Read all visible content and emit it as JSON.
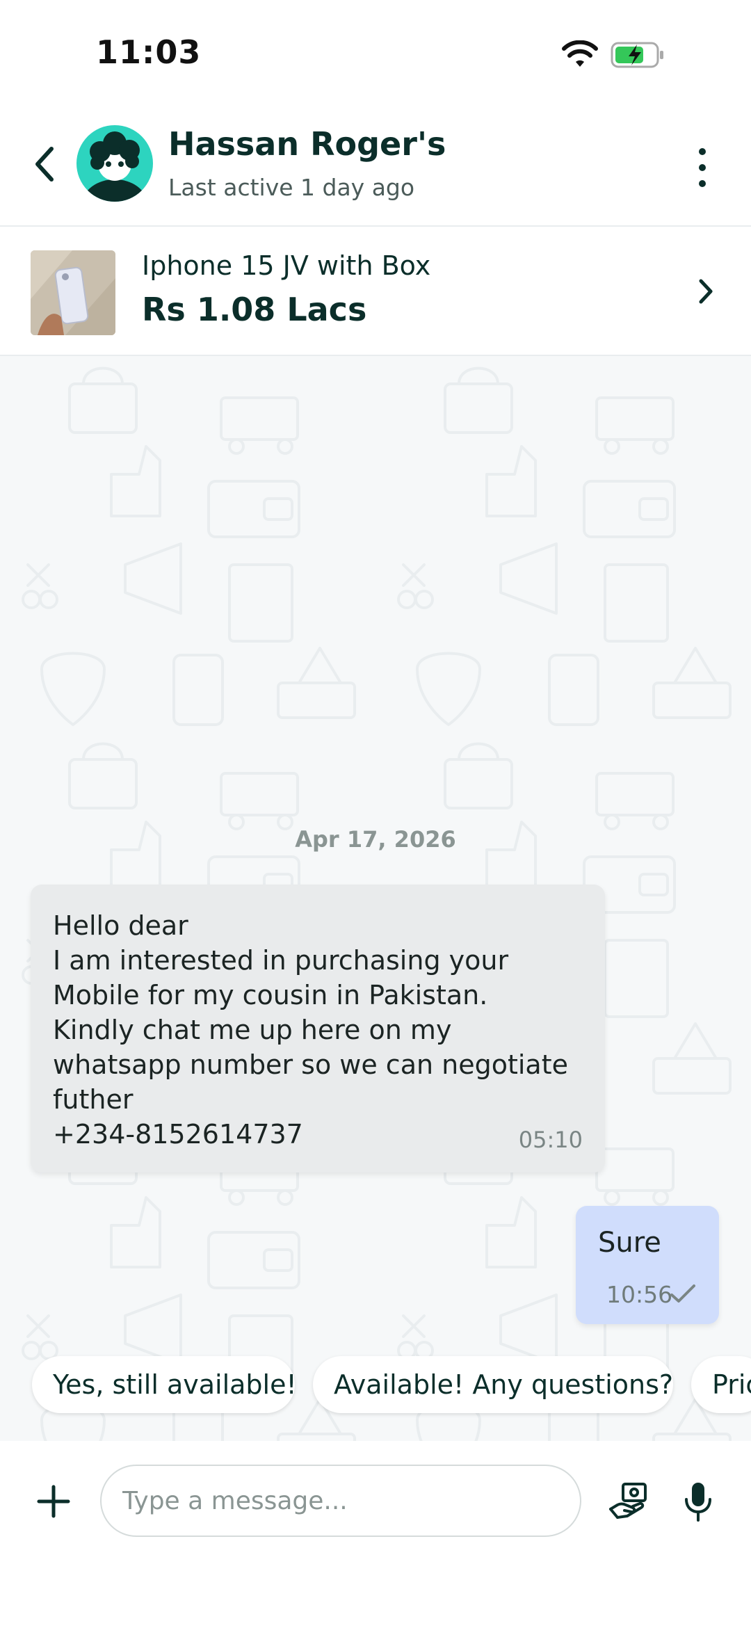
{
  "status_bar": {
    "time": "11:03"
  },
  "header": {
    "name": "Hassan Roger's",
    "last_active": "Last active 1 day ago"
  },
  "listing": {
    "title": "Iphone 15 JV with Box",
    "price": "Rs 1.08 Lacs"
  },
  "chat": {
    "date_separator": "Apr 17, 2026",
    "messages": [
      {
        "direction": "incoming",
        "text": "Hello dear\nI am interested in purchasing your Mobile for my cousin in Pakistan.\nKindly chat me up here on my whatsapp number so we can negotiate futher\n+234-8152614737",
        "time": "05:10"
      },
      {
        "direction": "outgoing",
        "text": "Sure",
        "time": "10:56",
        "status_icon": "single-check-icon"
      }
    ]
  },
  "quick_replies": [
    "Yes, still available!",
    "Available! Any questions?",
    "Pric"
  ],
  "composer": {
    "placeholder": "Type a message..."
  },
  "colors": {
    "brand_dark": "#0b2e2a",
    "avatar_bg": "#2dd4bf",
    "incoming_bubble": "#e9ebec",
    "outgoing_bubble": "#d0ddfc"
  }
}
